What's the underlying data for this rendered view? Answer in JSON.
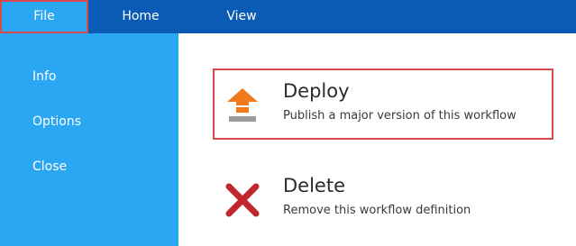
{
  "ribbon": {
    "tabs": [
      {
        "label": "File"
      },
      {
        "label": "Home"
      },
      {
        "label": "View"
      }
    ]
  },
  "sidebar": {
    "items": [
      {
        "label": "Info"
      },
      {
        "label": "Options"
      },
      {
        "label": "Close"
      }
    ]
  },
  "actions": [
    {
      "title": "Deploy",
      "description": "Publish a major version of this workflow",
      "icon": "upload-arrow-icon"
    },
    {
      "title": "Delete",
      "description": "Remove this workflow definition",
      "icon": "red-x-icon"
    }
  ],
  "colors": {
    "ribbon": "#0a5bb5",
    "sidebar": "#2aa7f2",
    "highlight_border": "#d94a4a",
    "deploy_icon": "#f07a1a",
    "delete_icon": "#c0282d"
  }
}
